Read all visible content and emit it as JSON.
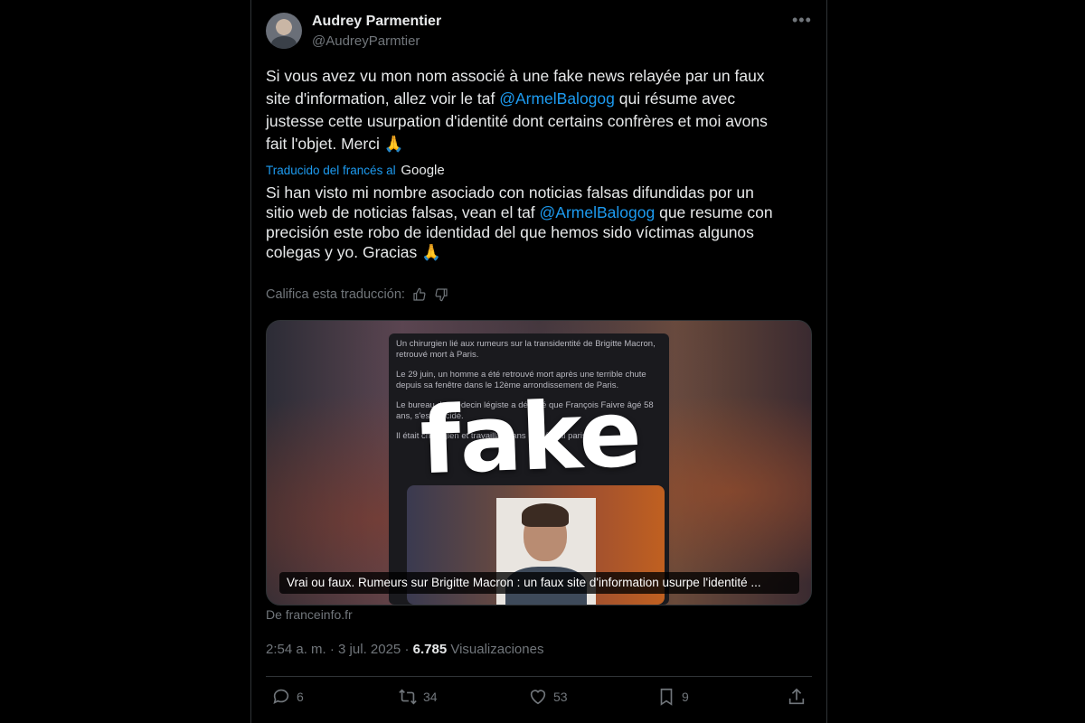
{
  "author": {
    "name": "Audrey Parmentier",
    "handle": "@AudreyParmtier"
  },
  "tweet": {
    "line1": "Si vous avez vu mon nom associé à une fake news relayée par un faux",
    "line2_pre": "site d'information, allez voir le taf ",
    "mention": "@ArmelBalogog",
    "line2_post": " qui résume avec",
    "line3": "justesse cette usurpation d'identité dont certains confrères et moi avons",
    "line4": "fait l'objet. Merci 🙏"
  },
  "translation": {
    "label": "Traducido del francés al",
    "provider": "Google",
    "line1": "Si han visto mi nombre asociado con noticias falsas difundidas por un",
    "line2_pre": "sitio web de noticias falsas, vean el taf ",
    "mention": "@ArmelBalogog",
    "line2_post": " que resume con",
    "line3": "precisión este robo de identidad del que hemos sido víctimas algunos",
    "line4": "colegas y yo. Gracias 🙏",
    "rate_label": "Califica esta traducción:"
  },
  "card": {
    "stamp": "fake",
    "article_p1": "Un chirurgien lié aux rumeurs sur la transidentité de Brigitte Macron, retrouvé mort à Paris.",
    "article_p2": "Le 29 juin, un homme a été retrouvé mort après une terrible chute depuis sa fenêtre dans le 12ème arrondissement de Paris.",
    "article_p3": "Le bureau du médecin légiste a déclaré que François Faivre âgé 58 ans, s'est suicidé.",
    "article_p4": "Il était chirurgien et travaillait dans un hôpital parisien...",
    "caption": "Vrai ou faux. Rumeurs sur Brigitte Macron : un faux site d'information usurpe l'identité ...",
    "source": "De franceinfo.fr"
  },
  "meta": {
    "time": "2:54 a. m.",
    "sep1": "·",
    "date": "3 jul. 2025",
    "sep2": "·",
    "views_count": "6.785",
    "views_label": "Visualizaciones"
  },
  "actions": {
    "replies": "6",
    "reposts": "34",
    "likes": "53",
    "bookmarks": "9"
  },
  "colors": {
    "background": "#000000",
    "text": "#e7e9ea",
    "muted": "#71767b",
    "accent": "#1d9bf0",
    "border": "#2f3336"
  },
  "icons": {
    "more": "more-icon",
    "thumbs_up": "thumbs-up-icon",
    "thumbs_down": "thumbs-down-icon",
    "reply": "reply-icon",
    "repost": "repost-icon",
    "like": "heart-icon",
    "bookmark": "bookmark-icon",
    "share": "share-icon"
  }
}
